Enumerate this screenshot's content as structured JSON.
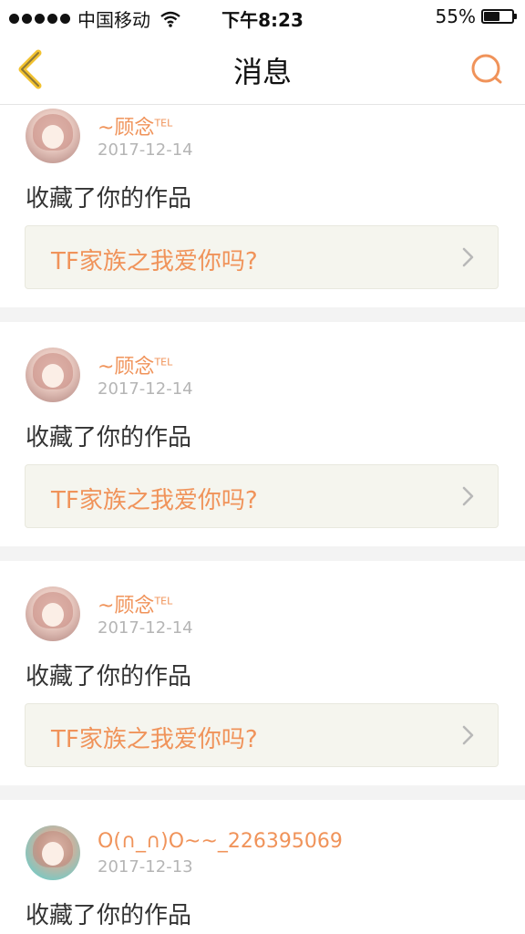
{
  "status_bar": {
    "carrier": "中国移动",
    "time": "下午8:23",
    "battery": "55%",
    "battery_level": 0.55
  },
  "nav": {
    "title": "消息"
  },
  "messages": [
    {
      "username": "~顾念",
      "badge": "TEL",
      "date": "2017-12-14",
      "action": "收藏了你的作品",
      "work_title": "TF家族之我爱你吗?"
    },
    {
      "username": "~顾念",
      "badge": "TEL",
      "date": "2017-12-14",
      "action": "收藏了你的作品",
      "work_title": "TF家族之我爱你吗?"
    },
    {
      "username": "~顾念",
      "badge": "TEL",
      "date": "2017-12-14",
      "action": "收藏了你的作品",
      "work_title": "TF家族之我爱你吗?"
    },
    {
      "username": "O(∩_∩)O~~_226395069",
      "badge": "",
      "date": "2017-12-13",
      "action": "收藏了你的作品",
      "work_title": ""
    }
  ],
  "colors": {
    "accent": "#f0935a",
    "back_icon": "#f2c230",
    "date": "#b5b5b5",
    "work_box_bg": "#f5f5ee",
    "separator": "#f3f3f3"
  },
  "icons": {
    "back": "chevron-left-icon",
    "search": "search-icon",
    "work_arrow": "chevron-right-icon"
  }
}
